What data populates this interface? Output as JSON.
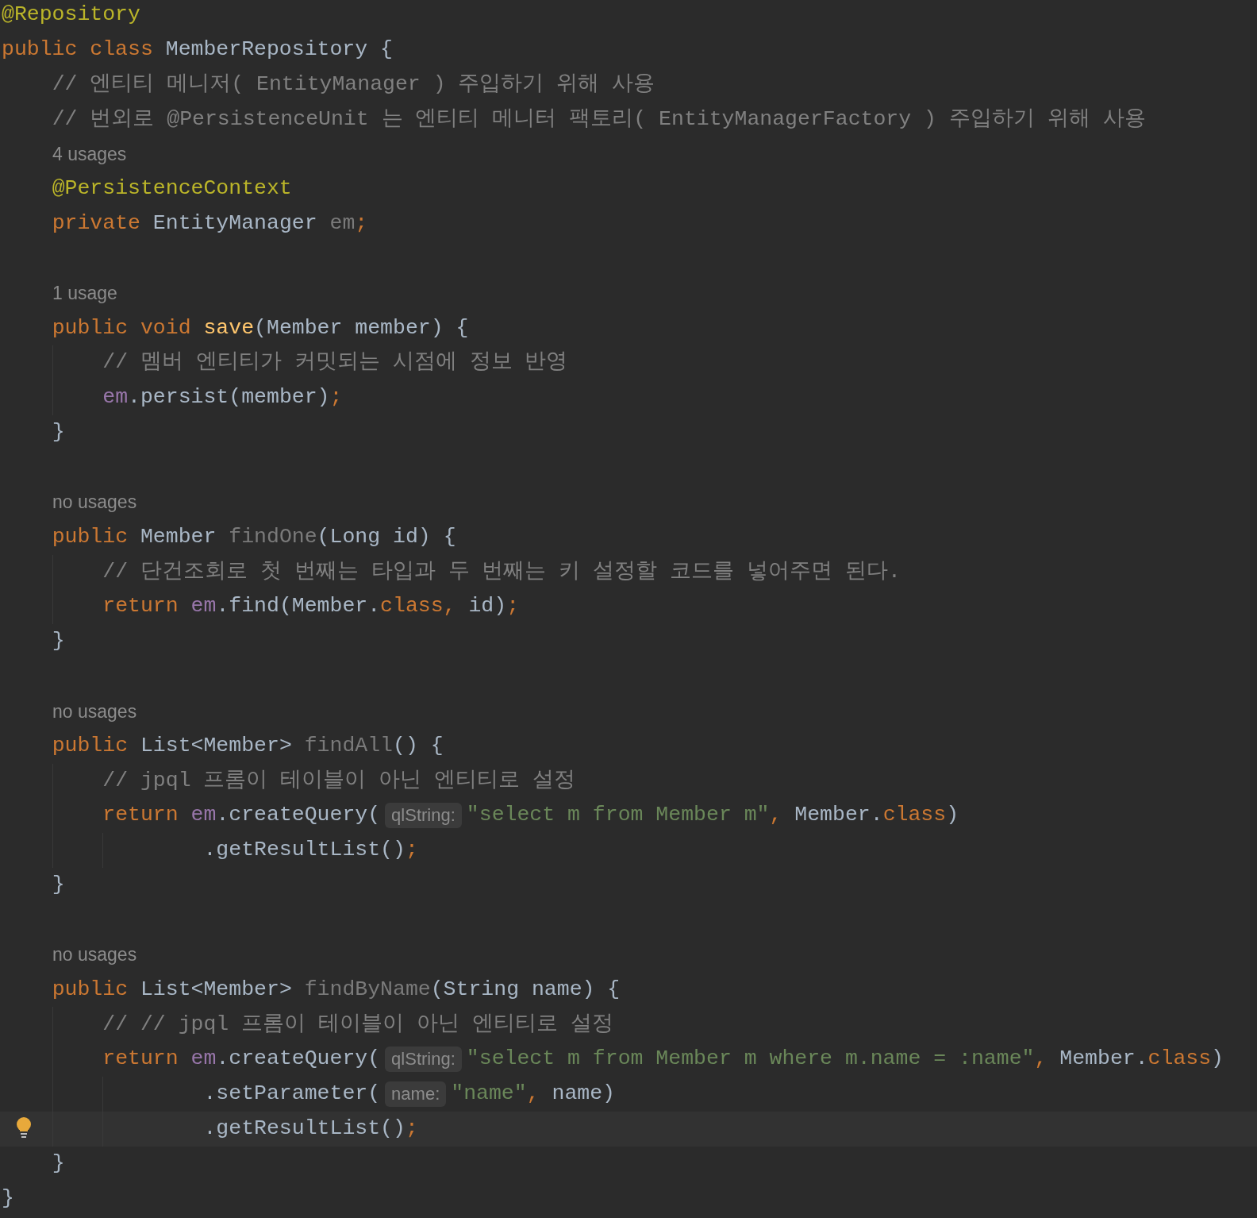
{
  "editor": {
    "lines": [
      {
        "kind": "code",
        "current": false,
        "tokens": [
          {
            "kind": "annotation",
            "text": "@Repository"
          }
        ]
      },
      {
        "kind": "code",
        "current": false,
        "tokens": [
          {
            "kind": "keyword",
            "text": "public class "
          },
          {
            "kind": "plain",
            "text": "MemberRepository {"
          }
        ]
      },
      {
        "kind": "code",
        "current": false,
        "tokens": [
          {
            "kind": "comment",
            "text": "    // 엔티티 메니저( EntityManager ) 주입하기 위해 사용"
          }
        ]
      },
      {
        "kind": "code",
        "current": false,
        "tokens": [
          {
            "kind": "comment",
            "text": "    // 번외로 @PersistenceUnit 는 엔티티 메니터 팩토리( EntityManagerFactory ) 주입하기 위해 사용"
          }
        ]
      },
      {
        "kind": "hint",
        "current": false,
        "text": "4 usages"
      },
      {
        "kind": "code",
        "current": false,
        "tokens": [
          {
            "kind": "annotation",
            "text": "    @PersistenceContext"
          }
        ]
      },
      {
        "kind": "code",
        "current": false,
        "tokens": [
          {
            "kind": "keyword",
            "text": "    private "
          },
          {
            "kind": "plain",
            "text": "EntityManager "
          },
          {
            "kind": "unused",
            "text": "em"
          },
          {
            "kind": "keyword",
            "text": ";"
          }
        ]
      },
      {
        "kind": "blank",
        "current": false
      },
      {
        "kind": "hint",
        "current": false,
        "text": "1 usage"
      },
      {
        "kind": "code",
        "current": false,
        "tokens": [
          {
            "kind": "keyword",
            "text": "    public void "
          },
          {
            "kind": "method",
            "text": "save"
          },
          {
            "kind": "plain",
            "text": "(Member member) {"
          }
        ]
      },
      {
        "kind": "code",
        "current": false,
        "tokens": [
          {
            "kind": "comment",
            "text": "        // 멤버 엔티티가 커밋되는 시점에 정보 반영"
          }
        ]
      },
      {
        "kind": "code",
        "current": false,
        "tokens": [
          {
            "kind": "field",
            "text": "        em"
          },
          {
            "kind": "plain",
            "text": ".persist(member)"
          },
          {
            "kind": "keyword",
            "text": ";"
          }
        ]
      },
      {
        "kind": "code",
        "current": false,
        "tokens": [
          {
            "kind": "plain",
            "text": "    }"
          }
        ]
      },
      {
        "kind": "blank",
        "current": false
      },
      {
        "kind": "hint",
        "current": false,
        "text": "no usages"
      },
      {
        "kind": "code",
        "current": false,
        "tokens": [
          {
            "kind": "keyword",
            "text": "    public "
          },
          {
            "kind": "plain",
            "text": "Member "
          },
          {
            "kind": "unused",
            "text": "findOne"
          },
          {
            "kind": "plain",
            "text": "(Long id) {"
          }
        ]
      },
      {
        "kind": "code",
        "current": false,
        "tokens": [
          {
            "kind": "comment",
            "text": "        // 단건조회로 첫 번째는 타입과 두 번째는 키 설정할 코드를 넣어주면 된다."
          }
        ]
      },
      {
        "kind": "code",
        "current": false,
        "tokens": [
          {
            "kind": "keyword",
            "text": "        return "
          },
          {
            "kind": "field",
            "text": "em"
          },
          {
            "kind": "plain",
            "text": ".find(Member."
          },
          {
            "kind": "keyword",
            "text": "class, "
          },
          {
            "kind": "plain",
            "text": "id)"
          },
          {
            "kind": "keyword",
            "text": ";"
          }
        ]
      },
      {
        "kind": "code",
        "current": false,
        "tokens": [
          {
            "kind": "plain",
            "text": "    }"
          }
        ]
      },
      {
        "kind": "blank",
        "current": false
      },
      {
        "kind": "hint",
        "current": false,
        "text": "no usages"
      },
      {
        "kind": "code",
        "current": false,
        "tokens": [
          {
            "kind": "keyword",
            "text": "    public "
          },
          {
            "kind": "plain",
            "text": "List<Member> "
          },
          {
            "kind": "unused",
            "text": "findAll"
          },
          {
            "kind": "plain",
            "text": "() {"
          }
        ]
      },
      {
        "kind": "code",
        "current": false,
        "tokens": [
          {
            "kind": "comment",
            "text": "        // jpql 프롬이 테이블이 아닌 엔티티로 설정"
          }
        ]
      },
      {
        "kind": "code",
        "current": false,
        "tokens": [
          {
            "kind": "keyword",
            "text": "        return "
          },
          {
            "kind": "field",
            "text": "em"
          },
          {
            "kind": "plain",
            "text": ".createQuery("
          },
          {
            "kind": "inlay",
            "text": "qlString:"
          },
          {
            "kind": "string",
            "text": "\"select m from Member m\""
          },
          {
            "kind": "keyword",
            "text": ", "
          },
          {
            "kind": "plain",
            "text": "Member."
          },
          {
            "kind": "keyword",
            "text": "class"
          },
          {
            "kind": "plain",
            "text": ")"
          }
        ]
      },
      {
        "kind": "code",
        "current": false,
        "tokens": [
          {
            "kind": "plain",
            "text": "                .getResultList()"
          },
          {
            "kind": "keyword",
            "text": ";"
          }
        ]
      },
      {
        "kind": "code",
        "current": false,
        "tokens": [
          {
            "kind": "plain",
            "text": "    }"
          }
        ]
      },
      {
        "kind": "blank",
        "current": false
      },
      {
        "kind": "hint",
        "current": false,
        "text": "no usages"
      },
      {
        "kind": "code",
        "current": false,
        "tokens": [
          {
            "kind": "keyword",
            "text": "    public "
          },
          {
            "kind": "plain",
            "text": "List<Member> "
          },
          {
            "kind": "unused",
            "text": "findByName"
          },
          {
            "kind": "plain",
            "text": "(String name) {"
          }
        ]
      },
      {
        "kind": "code",
        "current": false,
        "tokens": [
          {
            "kind": "comment",
            "text": "        // // jpql 프롬이 테이블이 아닌 엔티티로 설정"
          }
        ]
      },
      {
        "kind": "code",
        "current": false,
        "tokens": [
          {
            "kind": "keyword",
            "text": "        return "
          },
          {
            "kind": "field",
            "text": "em"
          },
          {
            "kind": "plain",
            "text": ".createQuery("
          },
          {
            "kind": "inlay",
            "text": "qlString:"
          },
          {
            "kind": "string",
            "text": "\"select m from Member m where m.name = :name\""
          },
          {
            "kind": "keyword",
            "text": ", "
          },
          {
            "kind": "plain",
            "text": "Member."
          },
          {
            "kind": "keyword",
            "text": "class"
          },
          {
            "kind": "plain",
            "text": ")"
          }
        ]
      },
      {
        "kind": "code",
        "current": false,
        "tokens": [
          {
            "kind": "plain",
            "text": "                .setParameter("
          },
          {
            "kind": "inlay",
            "text": "name:"
          },
          {
            "kind": "string",
            "text": "\"name\""
          },
          {
            "kind": "keyword",
            "text": ", "
          },
          {
            "kind": "plain",
            "text": "name)"
          }
        ]
      },
      {
        "kind": "code",
        "current": true,
        "tokens": [
          {
            "kind": "plain",
            "text": "                .getResultList()"
          },
          {
            "kind": "keyword",
            "text": ";"
          }
        ]
      },
      {
        "kind": "code",
        "current": false,
        "tokens": [
          {
            "kind": "plain",
            "text": "    }"
          }
        ]
      },
      {
        "kind": "code",
        "current": false,
        "tokens": [
          {
            "kind": "plain",
            "text": "}"
          }
        ]
      }
    ]
  }
}
